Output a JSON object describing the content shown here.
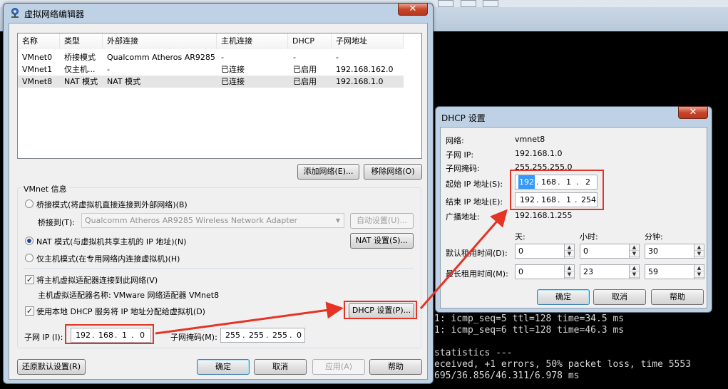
{
  "main_window": {
    "title": "虚拟网络编辑器",
    "close_label": "✕",
    "list": {
      "headers": [
        "名称",
        "类型",
        "外部连接",
        "主机连接",
        "DHCP",
        "子网地址"
      ],
      "rows": [
        [
          "VMnet0",
          "桥接模式",
          "Qualcomm Atheros AR9285 ...",
          "-",
          "-",
          "-"
        ],
        [
          "VMnet1",
          "仅主机...",
          "-",
          "已连接",
          "已启用",
          "192.168.162.0"
        ],
        [
          "VMnet8",
          "NAT 模式",
          "NAT 模式",
          "已连接",
          "已启用",
          "192.168.1.0"
        ]
      ]
    },
    "add_network": "添加网络(E)...",
    "remove_network": "移除网络(O)",
    "vmnet_info": "VMnet 信息",
    "bridge_mode": "桥接模式(将虚拟机直接连接到外部网络)(B)",
    "bridge_to_label": "桥接到(T):",
    "bridge_adapter": "Qualcomm Atheros AR9285 Wireless Network Adapter",
    "auto_settings": "自动设置(U)...",
    "nat_mode": "NAT 模式(与虚拟机共享主机的 IP 地址)(N)",
    "nat_settings": "NAT 设置(S)...",
    "host_only": "仅主机模式(在专用网络内连接虚拟机)(H)",
    "connect_host_adapter": "将主机虚拟适配器连接到此网络(V)",
    "host_adapter_name": "主机虚拟适配器名称: VMware 网络适配器 VMnet8",
    "use_dhcp": "使用本地 DHCP 服务将 IP 地址分配给虚拟机(D)",
    "dhcp_settings": "DHCP 设置(P)...",
    "subnet_ip_label": "子网 IP (I):",
    "subnet_ip": [
      "192",
      "168",
      "1",
      "0"
    ],
    "subnet_mask_label": "子网掩码(M):",
    "subnet_mask": [
      "255",
      "255",
      "255",
      "0"
    ],
    "restore_defaults": "还原默认设置(R)",
    "ok": "确定",
    "cancel": "取消",
    "apply": "应用(A)",
    "help": "帮助"
  },
  "dhcp_window": {
    "title": "DHCP 设置",
    "close_label": "✕",
    "network_label": "网络:",
    "network_value": "vmnet8",
    "subnet_ip_label": "子网 IP:",
    "subnet_ip_value": "192.168.1.0",
    "subnet_mask_label": "子网掩码:",
    "subnet_mask_value": "255.255.255.0",
    "start_ip_label": "起始 IP 地址(S):",
    "start_ip": [
      "192",
      "168",
      "1",
      "2"
    ],
    "end_ip_label": "结束 IP 地址(E):",
    "end_ip": [
      "192",
      "168",
      "1",
      "254"
    ],
    "broadcast_label": "广播地址:",
    "broadcast_value": "192.168.1.255",
    "col_days": "天:",
    "col_hours": "小时:",
    "col_minutes": "分钟:",
    "default_lease_label": "默认租用时间(D):",
    "default_lease": [
      "0",
      "0",
      "30"
    ],
    "max_lease_label": "最长租用时间(M):",
    "max_lease": [
      "0",
      "23",
      "59"
    ],
    "ok": "确定",
    "cancel": "取消",
    "help": "帮助"
  },
  "terminal": {
    "lines": [
      "1: icmp_seq=5 ttl=128 time=34.5 ms",
      "1: icmp_seq=6 ttl=128 time=46.3 ms",
      "",
      "statistics ---",
      "eceived, +1 errors, 50% packet loss, time 5553",
      "695/36.856/46.311/6.978 ms"
    ]
  },
  "colors": {
    "annotation": "#e53325",
    "window_frame": "#bfd1e5",
    "selection": "#3399ff"
  }
}
